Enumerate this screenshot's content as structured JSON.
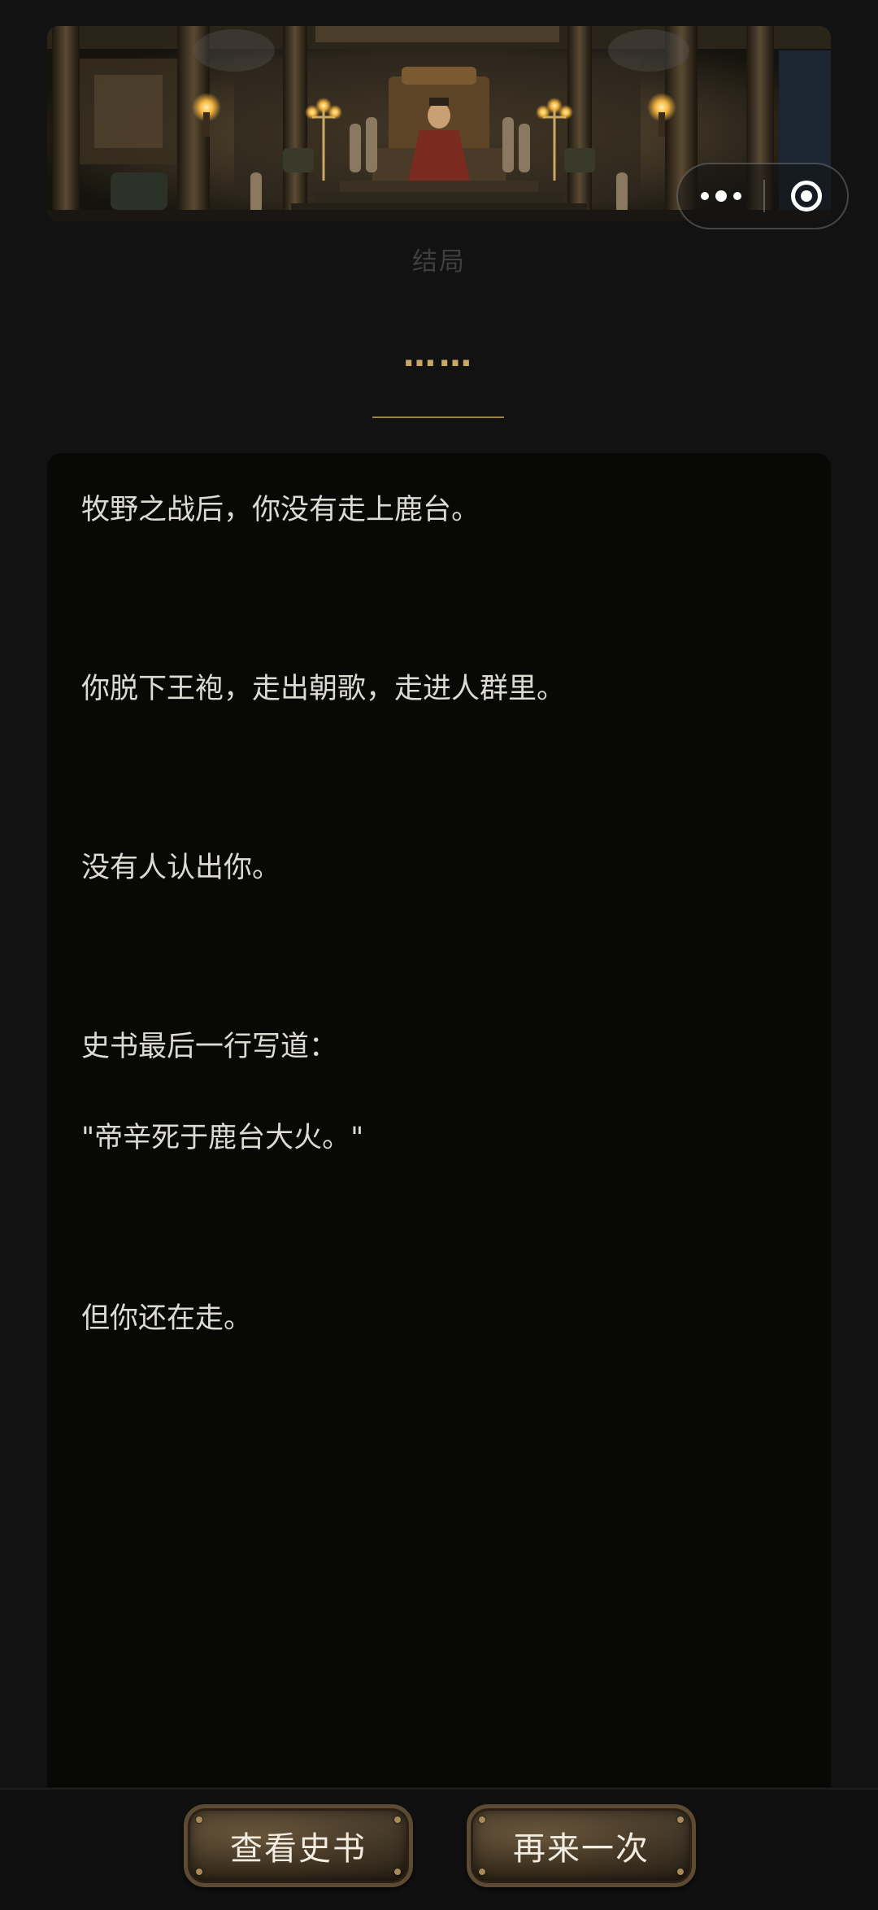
{
  "ending_label": "结局",
  "ellipsis": "……",
  "story": {
    "lines": [
      "牧野之战后，你没有走上鹿台。",
      "你脱下王袍，走出朝歌，走进人群里。",
      "没有人认出你。",
      "史书最后一行写道：",
      "\"帝辛死于鹿台大火。\"",
      "但你还在走。"
    ]
  },
  "buttons": {
    "view_history": "查看史书",
    "play_again": "再来一次"
  },
  "capsule": {
    "more_icon": "more-dots-icon",
    "close_icon": "target-close-icon"
  },
  "colors": {
    "accent": "#c9a764",
    "background": "#111211",
    "card": "#080907",
    "text": "#dcdad3"
  }
}
